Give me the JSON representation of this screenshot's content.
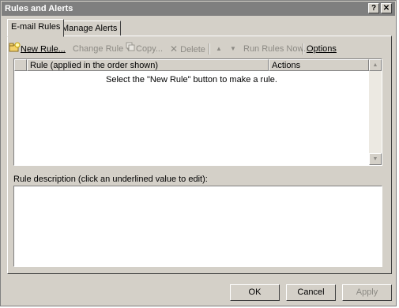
{
  "window": {
    "title": "Rules and Alerts",
    "help_glyph": "?",
    "close_glyph": "✕"
  },
  "tabs": [
    {
      "label": "E-mail Rules",
      "active": true
    },
    {
      "label": "Manage Alerts",
      "active": false
    }
  ],
  "toolbar": {
    "new_rule": {
      "label": "New Rule...",
      "icon": "new-rule-icon"
    },
    "change_rule": {
      "label": "Change Rule",
      "disabled": true
    },
    "copy": {
      "label": "Copy...",
      "icon": "copy-icon",
      "disabled": true
    },
    "delete": {
      "label": "Delete",
      "icon": "delete-icon",
      "glyph": "✕",
      "disabled": true
    },
    "move_up": {
      "icon": "arrow-up-icon",
      "glyph": "▲",
      "disabled": true
    },
    "move_down": {
      "icon": "arrow-down-icon",
      "glyph": "▼",
      "disabled": true
    },
    "run_rules": {
      "label": "Run Rules Now...",
      "disabled": true
    },
    "options": {
      "label": "Options"
    }
  },
  "rules_list": {
    "columns": [
      "Rule (applied in the order shown)",
      "Actions"
    ],
    "empty_message": "Select the \"New Rule\" button to make a rule."
  },
  "description": {
    "label": "Rule description (click an underlined value to edit):"
  },
  "buttons": {
    "ok": "OK",
    "cancel": "Cancel",
    "apply": "Apply"
  }
}
